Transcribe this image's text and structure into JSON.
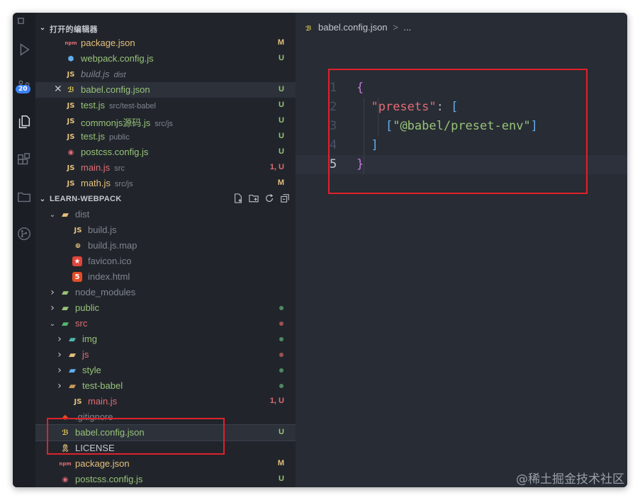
{
  "open_editors": {
    "header": "打开的编辑器",
    "items": [
      {
        "name": "package.json",
        "path": "",
        "status": "M",
        "icon": "npm-icon",
        "color": "#e5c07b",
        "italic": false
      },
      {
        "name": "webpack.config.js",
        "path": "",
        "status": "U",
        "icon": "webpack-icon",
        "color": "#98c379",
        "italic": false
      },
      {
        "name": "build.js",
        "path": "dist",
        "status": "",
        "icon": "js-icon",
        "color": "#7f848e",
        "italic": true
      },
      {
        "name": "babel.config.json",
        "path": "",
        "status": "U",
        "icon": "babel-icon",
        "color": "#98c379",
        "italic": false,
        "close": true
      },
      {
        "name": "test.js",
        "path": "src/test-babel",
        "status": "U",
        "icon": "js-icon",
        "color": "#98c379",
        "italic": false
      },
      {
        "name": "commonjs源码.js",
        "path": "src/js",
        "status": "U",
        "icon": "js-icon",
        "color": "#98c379",
        "italic": false
      },
      {
        "name": "test.js",
        "path": "public",
        "status": "U",
        "icon": "js-icon",
        "color": "#98c379",
        "italic": false
      },
      {
        "name": "postcss.config.js",
        "path": "",
        "status": "U",
        "icon": "postcss-icon",
        "color": "#98c379",
        "italic": false
      },
      {
        "name": "main.js",
        "path": "src",
        "status": "1, U",
        "icon": "js-icon",
        "color": "#e06c75",
        "italic": false
      },
      {
        "name": "math.js",
        "path": "src/js",
        "status": "M",
        "icon": "js-icon",
        "color": "#e5c07b",
        "italic": false
      }
    ]
  },
  "explorer": {
    "header": "LEARN-WEBPACK",
    "items": [
      {
        "name": "dist",
        "type": "folder",
        "depth": 0,
        "expanded": true,
        "color": "#7f848e",
        "icon": "folder-open-icon",
        "status": "",
        "dot": ""
      },
      {
        "name": "build.js",
        "type": "file",
        "depth": 1,
        "color": "#7f848e",
        "icon": "js-icon",
        "status": "",
        "dot": ""
      },
      {
        "name": "build.js.map",
        "type": "file",
        "depth": 1,
        "color": "#7f848e",
        "icon": "map-icon",
        "status": "",
        "dot": ""
      },
      {
        "name": "favicon.ico",
        "type": "file",
        "depth": 1,
        "color": "#7f848e",
        "icon": "favicon-icon",
        "status": "",
        "dot": ""
      },
      {
        "name": "index.html",
        "type": "file",
        "depth": 1,
        "color": "#7f848e",
        "icon": "html-icon",
        "status": "",
        "dot": ""
      },
      {
        "name": "node_modules",
        "type": "folder",
        "depth": 0,
        "expanded": false,
        "color": "#7f848e",
        "icon": "folder-node-icon",
        "status": "",
        "dot": ""
      },
      {
        "name": "public",
        "type": "folder",
        "depth": 0,
        "expanded": false,
        "color": "#98c379",
        "icon": "folder-public-icon",
        "status": "",
        "dot": "#4d8a63"
      },
      {
        "name": "src",
        "type": "folder",
        "depth": 0,
        "expanded": true,
        "color": "#e06c75",
        "icon": "folder-src-icon",
        "status": "",
        "dot": "#a0514f"
      },
      {
        "name": "img",
        "type": "folder",
        "depth": 1,
        "expanded": false,
        "color": "#98c379",
        "icon": "folder-img-icon",
        "status": "",
        "dot": "#4d8a63"
      },
      {
        "name": "js",
        "type": "folder",
        "depth": 1,
        "expanded": false,
        "color": "#e06c75",
        "icon": "folder-js-icon",
        "status": "",
        "dot": "#a0514f"
      },
      {
        "name": "style",
        "type": "folder",
        "depth": 1,
        "expanded": false,
        "color": "#98c379",
        "icon": "folder-style-icon",
        "status": "",
        "dot": "#4d8a63"
      },
      {
        "name": "test-babel",
        "type": "folder",
        "depth": 1,
        "expanded": false,
        "color": "#98c379",
        "icon": "folder-icon",
        "status": "",
        "dot": "#4d8a63"
      },
      {
        "name": "main.js",
        "type": "file",
        "depth": 1,
        "color": "#e06c75",
        "icon": "js-icon",
        "status": "1, U",
        "dot": ""
      },
      {
        "name": ".gitignore",
        "type": "file",
        "depth": 0,
        "color": "#7f848e",
        "icon": "git-icon",
        "status": "",
        "dot": ""
      },
      {
        "name": "babel.config.json",
        "type": "file",
        "depth": 0,
        "color": "#98c379",
        "icon": "babel-icon",
        "status": "U",
        "dot": "",
        "selected": true
      },
      {
        "name": "LICENSE",
        "type": "file",
        "depth": 0,
        "color": "#c5c8ce",
        "icon": "license-icon",
        "status": "",
        "dot": ""
      },
      {
        "name": "package.json",
        "type": "file",
        "depth": 0,
        "color": "#e5c07b",
        "icon": "npm-icon",
        "status": "M",
        "dot": ""
      },
      {
        "name": "postcss.config.js",
        "type": "file",
        "depth": 0,
        "color": "#98c379",
        "icon": "postcss-icon",
        "status": "U",
        "dot": ""
      }
    ]
  },
  "activity": {
    "badge": "20"
  },
  "editor": {
    "breadcrumb": {
      "file": "babel.config.json",
      "sep": ">",
      "rest": "..."
    },
    "lines": [
      {
        "num": "1",
        "tokens": [
          {
            "t": "{",
            "c": "#c678dd"
          }
        ]
      },
      {
        "num": "2",
        "tokens": [
          {
            "t": "  "
          },
          {
            "t": "\"presets\"",
            "c": "#e06c75"
          },
          {
            "t": ": ",
            "c": "#abb2bf"
          },
          {
            "t": "[",
            "c": "#61afef"
          }
        ]
      },
      {
        "num": "3",
        "tokens": [
          {
            "t": "    "
          },
          {
            "t": "[",
            "c": "#61afef"
          },
          {
            "t": "\"@babel/preset-env\"",
            "c": "#98c379"
          },
          {
            "t": "]",
            "c": "#61afef"
          }
        ]
      },
      {
        "num": "4",
        "tokens": [
          {
            "t": "  "
          },
          {
            "t": "]",
            "c": "#61afef"
          }
        ]
      },
      {
        "num": "5",
        "tokens": [
          {
            "t": "}",
            "c": "#c678dd"
          }
        ]
      }
    ],
    "active_line": "5"
  },
  "watermark": "@稀土掘金技术社区"
}
